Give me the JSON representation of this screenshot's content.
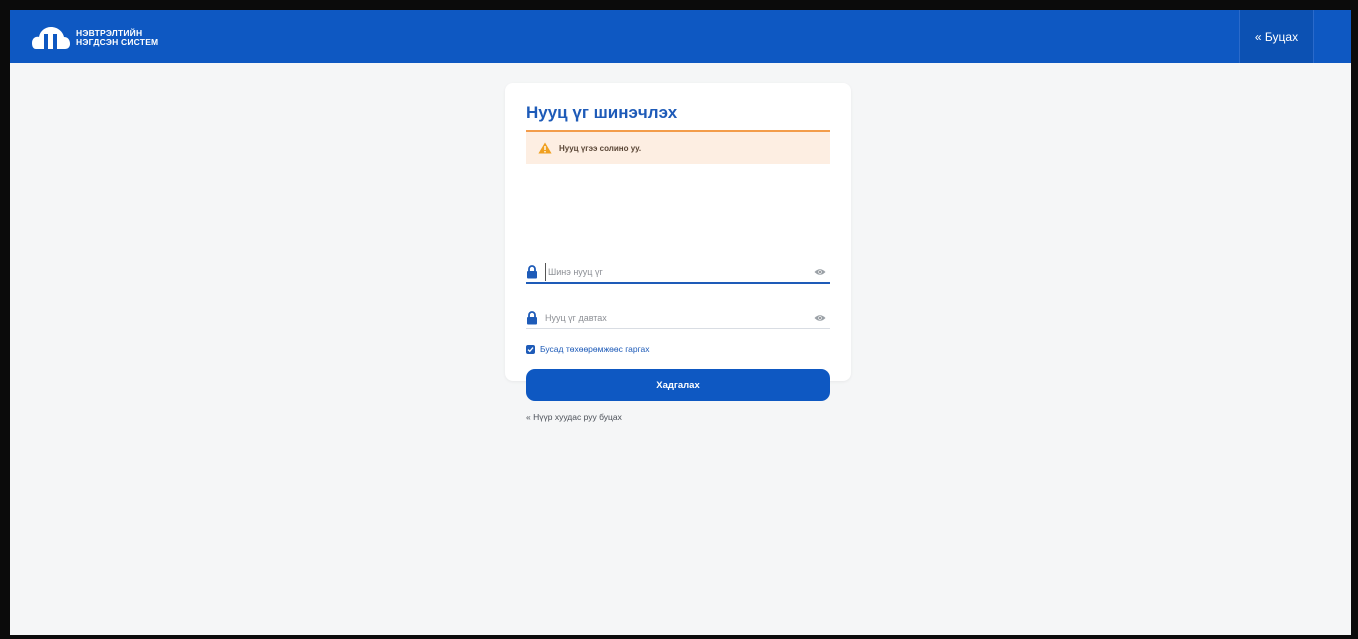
{
  "header": {
    "logo_line1": "НЭВТРЭЛТИЙН",
    "logo_line2": "НЭГДСЭН СИСТЕМ",
    "back_label": "« Буцах"
  },
  "card": {
    "title": "Нууц үг шинэчлэх",
    "alert_text": "Нууц үгээ солино уу.",
    "new_password_placeholder": "Шинэ нууц үг",
    "repeat_password_placeholder": "Нууц үг давтах",
    "checkbox_label": "Бусад төхөөрөмжөөс гаргах",
    "checkbox_checked": true,
    "save_label": "Хадгалах",
    "home_link": "« Нүүр хуудас руу буцах"
  },
  "colors": {
    "brand_blue": "#0e58c2",
    "title_blue": "#1e5bb8",
    "alert_bg": "#fdeee2",
    "alert_border": "#f39c4a",
    "warning_icon": "#f0a020"
  },
  "icons": [
    "logo-icon",
    "warning-icon",
    "lock-icon",
    "eye-icon",
    "check-icon"
  ]
}
